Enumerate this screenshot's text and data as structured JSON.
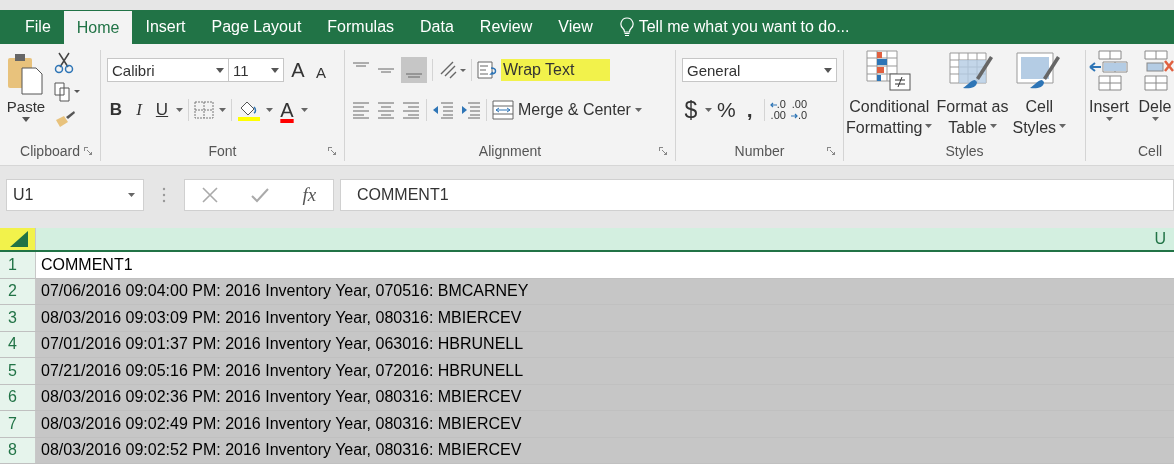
{
  "tabs": [
    {
      "label": "File",
      "selected": false
    },
    {
      "label": "Home",
      "selected": true
    },
    {
      "label": "Insert",
      "selected": false
    },
    {
      "label": "Page Layout",
      "selected": false
    },
    {
      "label": "Formulas",
      "selected": false
    },
    {
      "label": "Data",
      "selected": false
    },
    {
      "label": "Review",
      "selected": false
    },
    {
      "label": "View",
      "selected": false
    }
  ],
  "tell_me": "Tell me what you want to do...",
  "clipboard": {
    "paste": "Paste",
    "label": "Clipboard"
  },
  "font": {
    "name": "Calibri",
    "size": "11",
    "grow": "A",
    "shrink": "A",
    "bold": "B",
    "italic": "I",
    "underline": "U",
    "font_color": "A",
    "label": "Font"
  },
  "alignment": {
    "wrap_text": {
      "label": "Wrap Text",
      "highlighted": true
    },
    "merge": "Merge & Center",
    "label": "Alignment"
  },
  "number": {
    "format": "General",
    "currency": "$",
    "percent": "%",
    "comma": ",",
    "increase_decimal": [
      ".0",
      ".00"
    ],
    "decrease_decimal": [
      ".00",
      ".0"
    ],
    "label": "Number"
  },
  "styles": {
    "buttons": [
      {
        "label": [
          "Conditional",
          "Formatting"
        ],
        "kind": "conditional"
      },
      {
        "label": [
          "Format as",
          "Table"
        ],
        "kind": "table"
      },
      {
        "label": [
          "Cell",
          "Styles"
        ],
        "kind": "cell"
      }
    ],
    "label": "Styles"
  },
  "cells": {
    "buttons": [
      {
        "label": "Insert",
        "kind": "insert"
      },
      {
        "label": "Dele",
        "kind": "delete"
      }
    ],
    "label": "Cell"
  },
  "formula_bar": {
    "name_box": "U1",
    "fx": "fx",
    "value": "COMMENT1"
  },
  "sheet": {
    "column": "U",
    "rows": [
      {
        "number": "1",
        "value": "COMMENT1",
        "selected": false
      },
      {
        "number": "2",
        "value": "07/06/2016 09:04:00 PM: 2016 Inventory Year, 070516: BMCARNEY",
        "selected": true
      },
      {
        "number": "3",
        "value": "08/03/2016 09:03:09 PM: 2016 Inventory Year, 080316: MBIERCEV",
        "selected": true
      },
      {
        "number": "4",
        "value": "07/01/2016 09:01:37 PM: 2016 Inventory Year, 063016: HBRUNELL",
        "selected": true
      },
      {
        "number": "5",
        "value": "07/21/2016 09:05:16 PM: 2016 Inventory Year, 072016: HBRUNELL",
        "selected": true
      },
      {
        "number": "6",
        "value": "08/03/2016 09:02:36 PM: 2016 Inventory Year, 080316: MBIERCEV",
        "selected": true
      },
      {
        "number": "7",
        "value": "08/03/2016 09:02:49 PM: 2016 Inventory Year, 080316: MBIERCEV",
        "selected": true
      },
      {
        "number": "8",
        "value": "08/03/2016 09:02:52 PM: 2016 Inventory Year, 080316: MBIERCEV",
        "selected": true
      }
    ]
  }
}
